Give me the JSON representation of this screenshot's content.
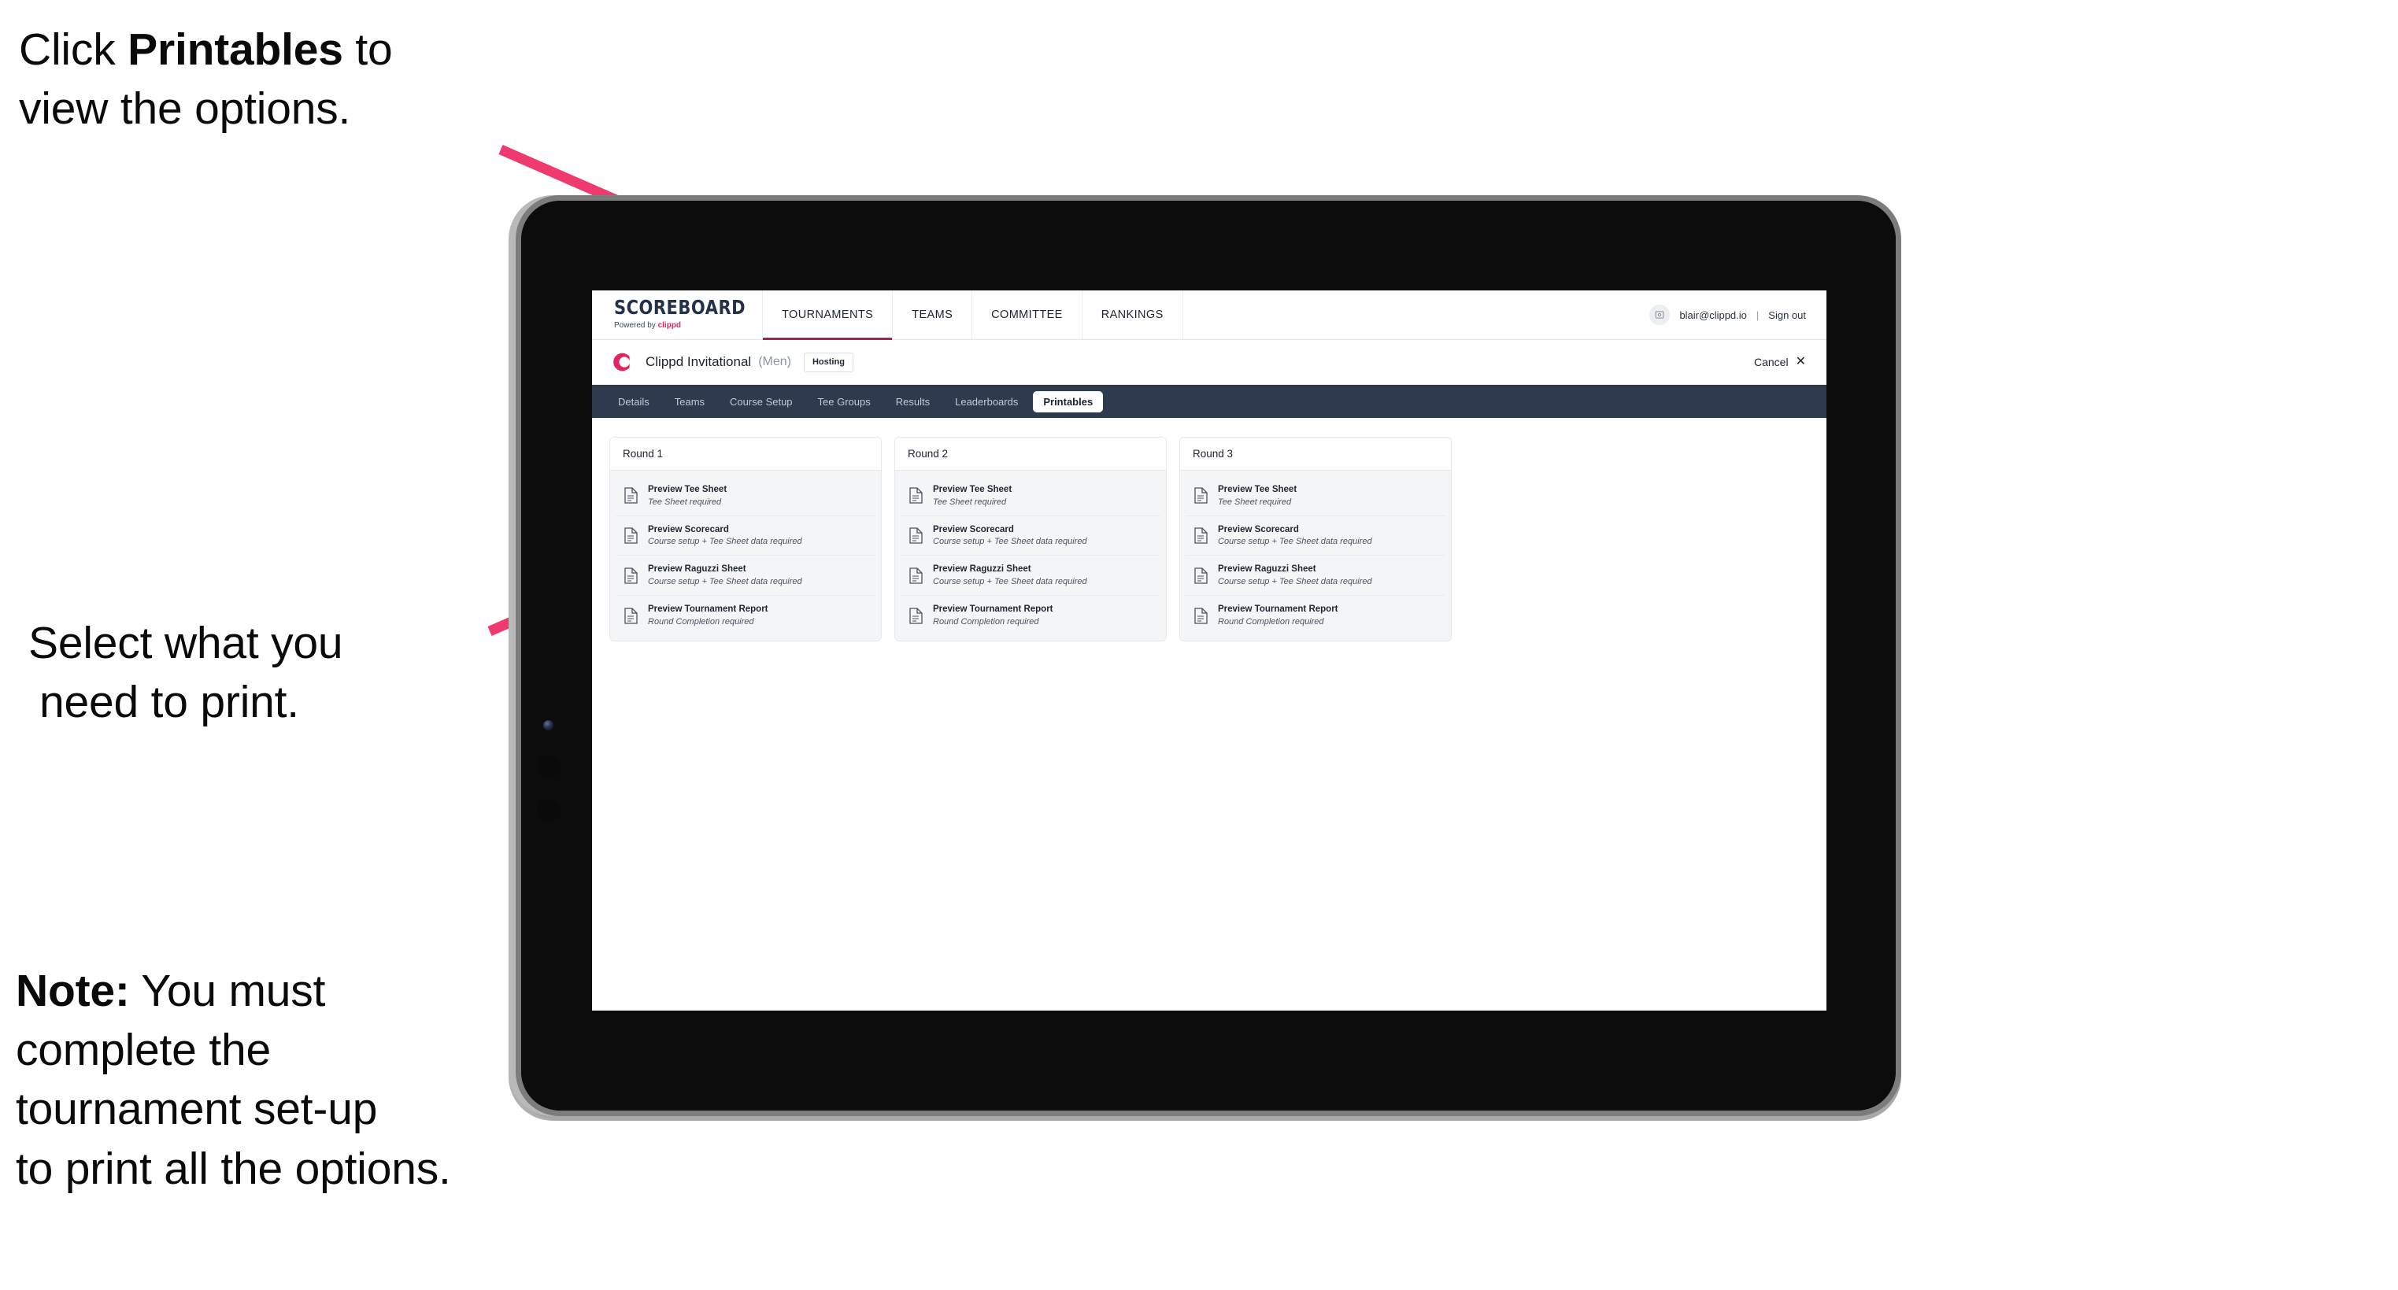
{
  "annotations": {
    "a1": {
      "pre": "Click ",
      "bold": "Printables",
      "post": " to",
      "line2": "view the options."
    },
    "a2": {
      "line1": "Select what you",
      "line2": "need to print."
    },
    "a3": {
      "bold": "Note:",
      "l1": " You must",
      "l2": "complete the",
      "l3": "tournament set-up",
      "l4": "to print all the options."
    }
  },
  "colors": {
    "accent_pink": "#ef3a6e",
    "brand_crimson": "#e3245e",
    "navbar_dark": "#2e3a4e",
    "active_underline": "#a8234a"
  },
  "browser": {
    "topbar": {
      "brand_title": "SCOREBOARD",
      "brand_sub_prefix": "Powered by ",
      "brand_sub_word": "clippd",
      "nav_items": [
        {
          "label": "TOURNAMENTS",
          "active": true
        },
        {
          "label": "TEAMS",
          "active": false
        },
        {
          "label": "COMMITTEE",
          "active": false
        },
        {
          "label": "RANKINGS",
          "active": false
        }
      ],
      "user_email": "blair@clippd.io",
      "divider": "|",
      "sign_out": "Sign out",
      "avatar_icon": "user-avatar-icon"
    },
    "titlebar": {
      "logo_icon": "clippd-c-logo",
      "tournament_name": "Clippd Invitational",
      "gender": "(Men)",
      "status_badge": "Hosting",
      "cancel_label": "Cancel",
      "cancel_icon": "✕"
    },
    "tabs": [
      {
        "label": "Details",
        "active": false
      },
      {
        "label": "Teams",
        "active": false
      },
      {
        "label": "Course Setup",
        "active": false
      },
      {
        "label": "Tee Groups",
        "active": false
      },
      {
        "label": "Results",
        "active": false
      },
      {
        "label": "Leaderboards",
        "active": false
      },
      {
        "label": "Printables",
        "active": true
      }
    ],
    "rounds": [
      {
        "title": "Round 1",
        "items": [
          {
            "title": "Preview Tee Sheet",
            "sub": "Tee Sheet required"
          },
          {
            "title": "Preview Scorecard",
            "sub": "Course setup + Tee Sheet data required"
          },
          {
            "title": "Preview Raguzzi Sheet",
            "sub": "Course setup + Tee Sheet data required"
          },
          {
            "title": "Preview Tournament Report",
            "sub": "Round Completion required"
          }
        ]
      },
      {
        "title": "Round 2",
        "items": [
          {
            "title": "Preview Tee Sheet",
            "sub": "Tee Sheet required"
          },
          {
            "title": "Preview Scorecard",
            "sub": "Course setup + Tee Sheet data required"
          },
          {
            "title": "Preview Raguzzi Sheet",
            "sub": "Course setup + Tee Sheet data required"
          },
          {
            "title": "Preview Tournament Report",
            "sub": "Round Completion required"
          }
        ]
      },
      {
        "title": "Round 3",
        "items": [
          {
            "title": "Preview Tee Sheet",
            "sub": "Tee Sheet required"
          },
          {
            "title": "Preview Scorecard",
            "sub": "Course setup + Tee Sheet data required"
          },
          {
            "title": "Preview Raguzzi Sheet",
            "sub": "Course setup + Tee Sheet data required"
          },
          {
            "title": "Preview Tournament Report",
            "sub": "Round Completion required"
          }
        ]
      }
    ]
  }
}
